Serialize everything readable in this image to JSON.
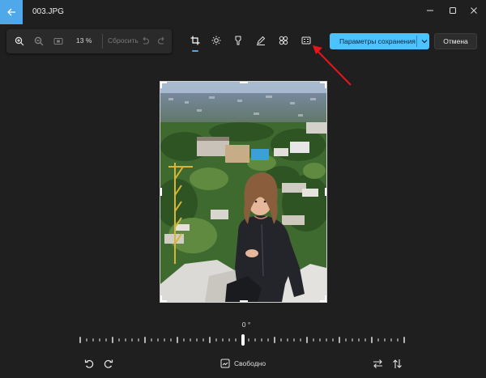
{
  "window": {
    "title": "003.JPG"
  },
  "zoom": {
    "percent": "13 %",
    "reset_label": "Сбросить"
  },
  "toolbar": {
    "tools": [
      {
        "name": "crop",
        "active": true
      },
      {
        "name": "adjust"
      },
      {
        "name": "retouch"
      },
      {
        "name": "markup"
      },
      {
        "name": "filter"
      },
      {
        "name": "background"
      }
    ]
  },
  "actions": {
    "save_label": "Параметры сохранения",
    "cancel_label": "Отмена"
  },
  "rotation": {
    "angle_label": "0 °"
  },
  "bottom": {
    "aspect_label": "Свободно"
  },
  "colors": {
    "accent": "#4cc2ff",
    "background": "#1f1f1f"
  }
}
